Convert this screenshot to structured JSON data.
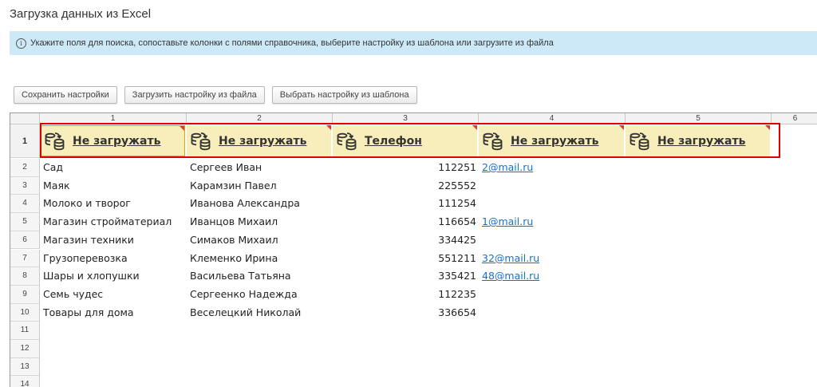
{
  "title": "Загрузка данных из Excel",
  "info_text": "Укажите поля для поиска, сопоставьте колонки с полями справочника, выберите настройку из шаблона или загрузите из файла",
  "toolbar": {
    "save_label": "Сохранить настройки",
    "load_file_label": "Загрузить настройку из файла",
    "template_label": "Выбрать настройку из шаблона"
  },
  "columns": [
    "1",
    "2",
    "3",
    "4",
    "5",
    "6"
  ],
  "header_row_number": "1",
  "header_cells": [
    "Не загружать",
    "Не загружать",
    "Телефон",
    "Не загружать",
    "Не загружать"
  ],
  "rows": [
    {
      "n": "2",
      "name": "Сад",
      "contact": "Сергеев Иван",
      "phone": "112251",
      "email": "2@mail.ru"
    },
    {
      "n": "3",
      "name": "Маяк",
      "contact": "Карамзин Павел",
      "phone": "225552",
      "email": ""
    },
    {
      "n": "4",
      "name": "Молоко и творог",
      "contact": "Иванова Александра",
      "phone": "111254",
      "email": ""
    },
    {
      "n": "5",
      "name": "Магазин стройматериал",
      "contact": "Иванцов Михаил",
      "phone": "116654",
      "email": "1@mail.ru"
    },
    {
      "n": "6",
      "name": "Магазин техники",
      "contact": "Симаков Михаил",
      "phone": "334425",
      "email": ""
    },
    {
      "n": "7",
      "name": "Грузоперевозка",
      "contact": "Клеменко Ирина",
      "phone": "551211",
      "email": "32@mail.ru"
    },
    {
      "n": "8",
      "name": "Шары и хлопушки",
      "contact": "Васильева Татьяна",
      "phone": "335421",
      "email": "48@mail.ru"
    },
    {
      "n": "9",
      "name": "Семь чудес",
      "contact": "Сергеенко Надежда",
      "phone": "112235",
      "email": ""
    },
    {
      "n": "10",
      "name": "Товары для дома",
      "contact": "Веселецкий Николай",
      "phone": "336654",
      "email": ""
    }
  ],
  "empty_rows": [
    "11",
    "12",
    "13",
    "14"
  ],
  "colors": {
    "info_bg": "#cde9f8",
    "header_bg": "#f8eebc",
    "highlight_border": "#e00000",
    "link": "#1a6fc8"
  },
  "icons": {
    "info": "info-icon",
    "column_mapping": "database-sync-icon"
  }
}
